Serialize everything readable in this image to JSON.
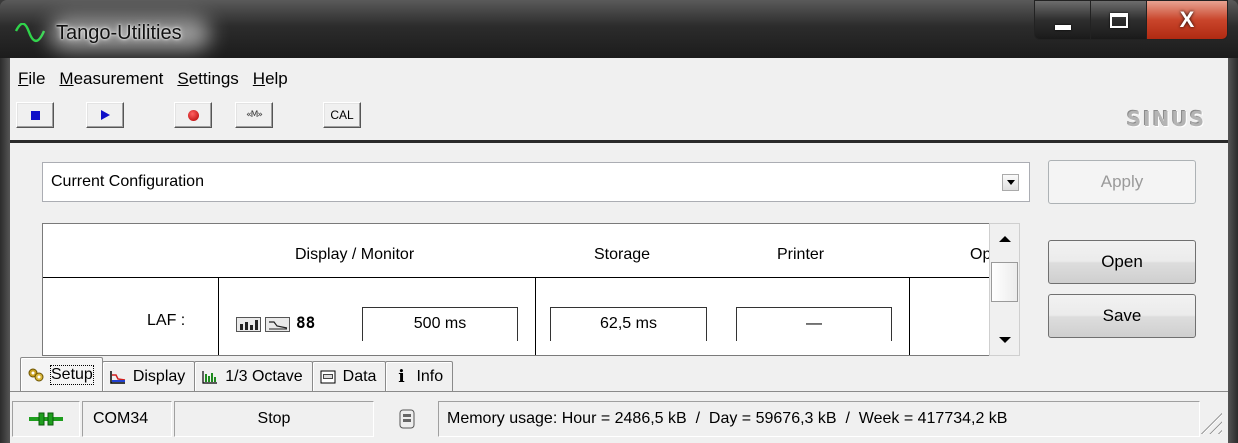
{
  "window": {
    "title": "Tango-Utilities",
    "caption_close": "X"
  },
  "menu": [
    {
      "label": "File",
      "accel": "F",
      "rest": "ile"
    },
    {
      "label": "Measurement",
      "accel": "M",
      "rest": "easurement"
    },
    {
      "label": "Settings",
      "accel": "S",
      "rest": "ettings"
    },
    {
      "label": "Help",
      "accel": "H",
      "rest": "elp"
    }
  ],
  "toolbar": {
    "stop_icon": "stop-icon",
    "play_icon": "play-icon",
    "record_icon": "record-icon",
    "marker_icon": "marker-icon",
    "marker_glyph": "«M»",
    "cal_label": "CAL",
    "brand": "SINUS"
  },
  "config": {
    "selected": "Current Configuration",
    "apply_label": "Apply",
    "open_label": "Open",
    "save_label": "Save"
  },
  "grid": {
    "headers": [
      "Display / Monitor",
      "Storage",
      "Printer",
      "Op"
    ],
    "rows": [
      {
        "label": "LAF :",
        "display_icons": [
          "bar-chart-icon",
          "curve-icon",
          "digits-icon"
        ],
        "digits_glyph": "88",
        "display_value": "500 ms",
        "storage_value": "62,5 ms",
        "printer_value": "—"
      }
    ]
  },
  "tabs": [
    {
      "label": "Setup",
      "icon": "setup-icon",
      "active": true
    },
    {
      "label": "Display",
      "icon": "display-icon",
      "active": false
    },
    {
      "label": "1/3 Octave",
      "icon": "octave-icon",
      "active": false
    },
    {
      "label": "Data",
      "icon": "data-icon",
      "active": false
    },
    {
      "label": "Info",
      "icon": "info-icon",
      "glyph": "i",
      "active": false
    }
  ],
  "status": {
    "connection_icon": "connection-icon",
    "port": "COM34",
    "state": "Stop",
    "memory_icon": "memory-icon",
    "memory": "Memory usage: Hour = 2486,5 kB  /  Day = 59676,3 kB  /  Week = 417734,2 kB"
  },
  "colors": {
    "title_bar": "#1c1c1c",
    "close_button": "#c9452b",
    "window_bg": "#f0f0f0",
    "accent_blue": "#1010c8",
    "record_red": "#b00000",
    "connection_green": "#1e9e1e"
  }
}
